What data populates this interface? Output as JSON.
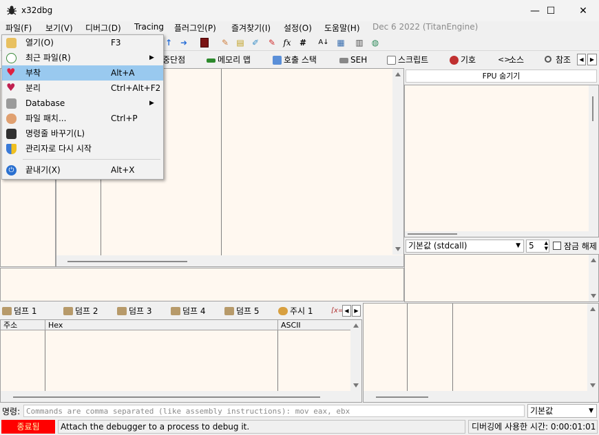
{
  "window": {
    "title": "x32dbg",
    "minimize": "—",
    "maximize": "☐",
    "close": "✕"
  },
  "menubar": {
    "items": [
      "파일(F)",
      "보기(V)",
      "디버그(D)",
      "Tracing",
      "플러그인(P)",
      "즐겨찾기(I)",
      "설정(O)",
      "도움말(H)"
    ],
    "build_info": "Dec 6 2022 (TitanEngine)"
  },
  "file_menu": {
    "items": [
      {
        "label": "열기(O)",
        "shortcut": "F3",
        "icon": "folder-icon",
        "submenu": false
      },
      {
        "label": "최근 파일(R)",
        "shortcut": "",
        "icon": "recent-icon",
        "submenu": true
      },
      {
        "label": "부착",
        "shortcut": "Alt+A",
        "icon": "heart-icon",
        "submenu": false,
        "highlighted": true
      },
      {
        "label": "분리",
        "shortcut": "Ctrl+Alt+F2",
        "icon": "broken-heart-icon",
        "submenu": false
      },
      {
        "label": "Database",
        "shortcut": "",
        "icon": "database-icon",
        "submenu": true
      },
      {
        "label": "파일 패치...",
        "shortcut": "Ctrl+P",
        "icon": "bandage-icon",
        "submenu": false
      },
      {
        "label": "명령줄 바꾸기(L)",
        "shortcut": "",
        "icon": "terminal-icon",
        "submenu": false
      },
      {
        "label": "관리자로 다시 시작",
        "shortcut": "",
        "icon": "shield-icon",
        "submenu": false
      },
      {
        "label": "끝내기(X)",
        "shortcut": "Alt+X",
        "icon": "power-icon",
        "submenu": false
      }
    ],
    "submenu_arrow": "▶"
  },
  "view_tabs": [
    "중단점",
    "메모리 맵",
    "호출 스택",
    "SEH",
    "스크립트",
    "기호",
    "소스",
    "참조"
  ],
  "fpu": {
    "toggle_label": "FPU 숨기기"
  },
  "calling_convention": {
    "value": "기본값 (stdcall)",
    "count": "5",
    "lock_label": "잠금 해제"
  },
  "dump_tabs": [
    "덤프 1",
    "덤프 2",
    "덤프 3",
    "덤프 4",
    "덤프 5",
    "주시 1",
    "[x="
  ],
  "dump_columns": [
    "주소",
    "Hex",
    "ASCII"
  ],
  "command": {
    "label": "명령:",
    "placeholder": "Commands are comma separated (like assembly instructions): mov eax, ebx",
    "mode": "기본값"
  },
  "status": {
    "state": "종료됨",
    "message": "Attach the debugger to a process to debug it.",
    "time": "디버깅에 사용한 시간: 0:00:01:01"
  },
  "colors": {
    "state_bg": "#ff0000",
    "pane_bg": "#fff8f0",
    "highlight": "#99c9ef"
  }
}
